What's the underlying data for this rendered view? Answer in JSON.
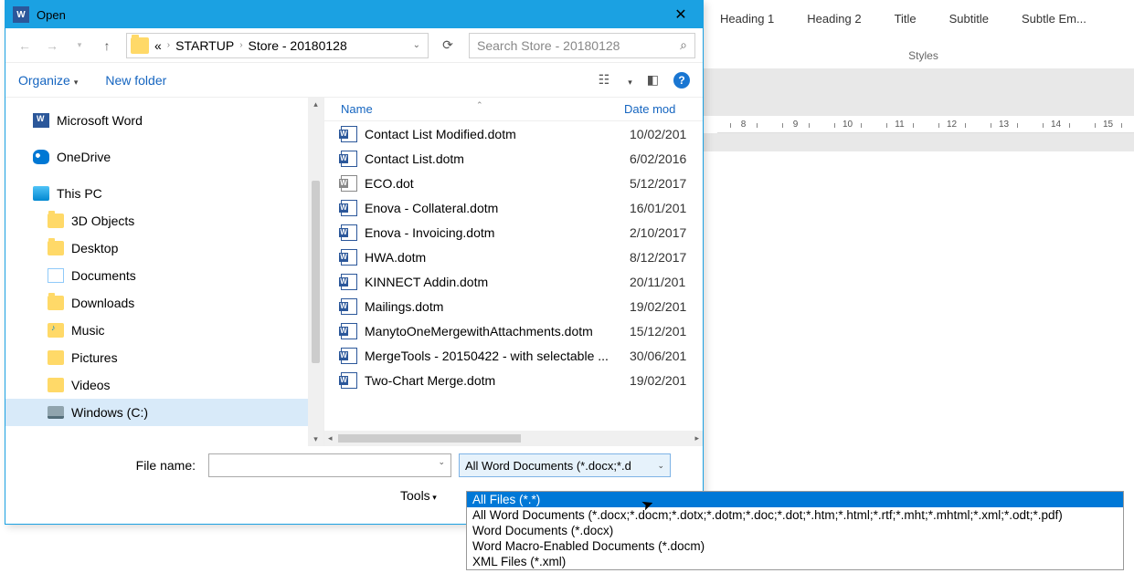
{
  "word_background": {
    "styles": [
      "Heading 1",
      "Heading 2",
      "Title",
      "Subtitle",
      "Subtle Em..."
    ],
    "styles_label": "Styles",
    "ruler_marks": [
      "8",
      "9",
      "10",
      "11",
      "12",
      "13",
      "14",
      "15"
    ]
  },
  "dialog": {
    "title": "Open",
    "breadcrumb": {
      "ellipsis": "«",
      "parts": [
        "STARTUP",
        "Store - 20180128"
      ]
    },
    "search_placeholder": "Search Store - 20180128",
    "toolbar": {
      "organize": "Organize",
      "newfolder": "New folder"
    },
    "sidebar": [
      {
        "label": "Microsoft Word",
        "icon": "word",
        "lvl": 0
      },
      {
        "label": "OneDrive",
        "icon": "onedrive",
        "lvl": 0
      },
      {
        "label": "This PC",
        "icon": "pc",
        "lvl": 0
      },
      {
        "label": "3D Objects",
        "icon": "folder",
        "lvl": 1
      },
      {
        "label": "Desktop",
        "icon": "folder",
        "lvl": 1
      },
      {
        "label": "Documents",
        "icon": "docs",
        "lvl": 1
      },
      {
        "label": "Downloads",
        "icon": "folder",
        "lvl": 1
      },
      {
        "label": "Music",
        "icon": "music",
        "lvl": 1
      },
      {
        "label": "Pictures",
        "icon": "pics",
        "lvl": 1
      },
      {
        "label": "Videos",
        "icon": "vid",
        "lvl": 1
      },
      {
        "label": "Windows (C:)",
        "icon": "drive",
        "lvl": 1,
        "selected": true
      }
    ],
    "columns": {
      "name": "Name",
      "date": "Date mod"
    },
    "files": [
      {
        "name": "Contact List Modified.dotm",
        "date": "10/02/201"
      },
      {
        "name": "Contact List.dotm",
        "date": "6/02/2016"
      },
      {
        "name": "ECO.dot",
        "date": "5/12/2017",
        "old": true
      },
      {
        "name": "Enova - Collateral.dotm",
        "date": "16/01/201"
      },
      {
        "name": "Enova - Invoicing.dotm",
        "date": "2/10/2017"
      },
      {
        "name": "HWA.dotm",
        "date": "8/12/2017"
      },
      {
        "name": "KINNECT Addin.dotm",
        "date": "20/11/201"
      },
      {
        "name": "Mailings.dotm",
        "date": "19/02/201"
      },
      {
        "name": "ManytoOneMergewithAttachments.dotm",
        "date": "15/12/201"
      },
      {
        "name": "MergeTools - 20150422 - with selectable ...",
        "date": "30/06/201"
      },
      {
        "name": "Two-Chart Merge.dotm",
        "date": "19/02/201"
      }
    ],
    "footer": {
      "filename_label": "File name:",
      "filter_label": "All Word Documents (*.docx;*.d",
      "tools": "Tools"
    },
    "dropdown": [
      "All Files (*.*)",
      "All Word Documents (*.docx;*.docm;*.dotx;*.dotm;*.doc;*.dot;*.htm;*.html;*.rtf;*.mht;*.mhtml;*.xml;*.odt;*.pdf)",
      "Word Documents (*.docx)",
      "Word Macro-Enabled Documents (*.docm)",
      "XML Files (*.xml)"
    ]
  }
}
